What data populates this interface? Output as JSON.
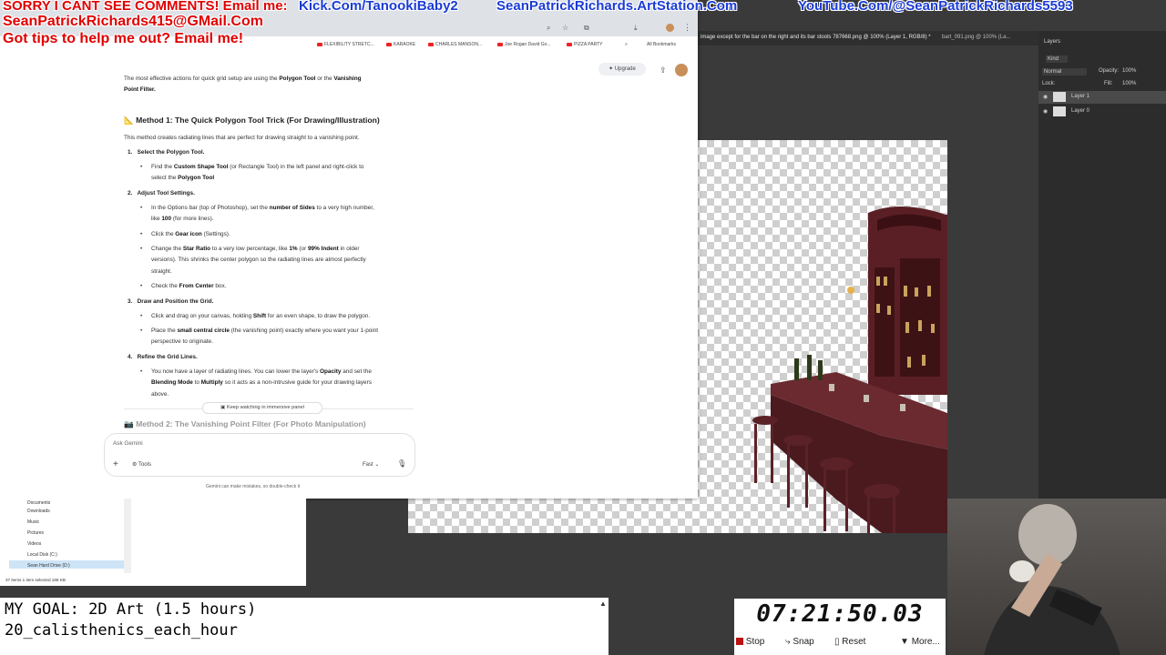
{
  "overlay": {
    "line1": "SORRY I CANT SEE COMMENTS! Email me:",
    "line2": "SeanPatrickRichards415@GMail.Com",
    "line3": "Got tips to help me out? Email me!",
    "links": [
      "Kick.Com/TanookiBaby2",
      "SeanPatrickRichards.ArtStation.Com",
      "YouTube.Com/@SeanPatrickRichards5593"
    ],
    "colors": {
      "red": "#e00000",
      "blue": "#1a3bd6"
    }
  },
  "bookmarks": [
    "FLEXIBILITY STRETC...",
    "KARAOKE",
    "CHARLES MANSON...",
    "Joe Rogan David Go...",
    "PIZZA PARTY",
    "All Bookmarks"
  ],
  "photoshop": {
    "tabs": [
      "image except for the bar on the right and its bar stools 787668.png @ 100% (Layer 1, RGB/8) *",
      "bart_091.png @ 100% (La..."
    ],
    "panel_title": "Layers",
    "kind": "Kind",
    "blend": "Normal",
    "opacity_label": "Opacity:",
    "opacity": "100%",
    "lock_label": "Lock:",
    "fill_label": "Fill:",
    "fill": "100%",
    "layers": [
      "Layer 1",
      "Layer 0"
    ]
  },
  "gemini": {
    "upgrade": "Upgrade",
    "intro_1": "The most effective actions for quick grid setup are using the",
    "intro_bold1": "Polygon Tool",
    "intro_or": "or the",
    "intro_bold2": "Vanishing",
    "intro_2": "Point Filter.",
    "method1_title": "Method 1: The Quick Polygon Tool Trick (For Drawing/Illustration)",
    "method1_desc": "This method creates radiating lines that are perfect for drawing straight to a vanishing point.",
    "steps": [
      {
        "num": "1.",
        "title": "Select the Polygon Tool."
      },
      {
        "num": "2.",
        "title": "Adjust Tool Settings."
      },
      {
        "num": "3.",
        "title": "Draw and Position the Grid."
      },
      {
        "num": "4.",
        "title": "Refine the Grid Lines."
      }
    ],
    "b1a": "Find the",
    "b1b": "Custom Shape Tool",
    "b1c": "(or Rectangle Tool) in the left panel and right-click to",
    "b1d": "select the",
    "b1e": "Polygon Tool",
    "b2a": "In the Options bar (top of Photoshop), set the",
    "b2b": "number of Sides",
    "b2c": "to a very high number,",
    "b2d": "like",
    "b2e": "100",
    "b2f": "(for more lines).",
    "b3a": "Click the",
    "b3b": "Gear icon",
    "b3c": "(Settings).",
    "b4a": "Change the",
    "b4b": "Star Ratio",
    "b4c": "to a very low percentage, like",
    "b4d": "1%",
    "b4e": "(or",
    "b4f": "99% Indent",
    "b4g": "in older",
    "b4h": "versions). This shrinks the center polygon so the radiating lines are almost perfectly",
    "b4i": "straight.",
    "b5a": "Check the",
    "b5b": "From Center",
    "b5c": "box.",
    "b6a": "Click and drag on your canvas, holding",
    "b6b": "Shift",
    "b6c": "for an even shape, to draw the polygon.",
    "b7a": "Place the",
    "b7b": "small central circle",
    "b7c": "(the vanishing point) exactly where you want your 1-point",
    "b7d": "perspective to originate.",
    "b8a": "You now have a layer of radiating lines. You can lower the layer's",
    "b8b": "Opacity",
    "b8c": "and set the",
    "b8d": "Blending Mode",
    "b8e": "to",
    "b8f": "Multiply",
    "b8g": "so it acts as a non-intrusive guide for your drawing layers",
    "b8h": "above.",
    "method2_title": "Method 2: The Vanishing Point Filter (For Photo Manipulation)",
    "immersive": "Keep watching in immersive panel",
    "ask_placeholder": "Ask Gemini",
    "tools": "Tools",
    "mode": "Fast",
    "disclaimer": "Gemini can make mistakes, so double-check it"
  },
  "explorer": {
    "items": [
      "Documents",
      "Downloads",
      "Music",
      "Pictures",
      "Videos",
      "Local Disk (C:)",
      "Sean Hard Drive (D:)"
    ],
    "status": "37 items    1 item selected  166 KB"
  },
  "goal": {
    "line1": "MY GOAL: 2D Art (1.5 hours)",
    "line2": "20_calisthenics_each_hour"
  },
  "timer": {
    "time": "07:21:50.03",
    "stop": "Stop",
    "snap": "Snap",
    "reset": "Reset",
    "more": "More..."
  }
}
